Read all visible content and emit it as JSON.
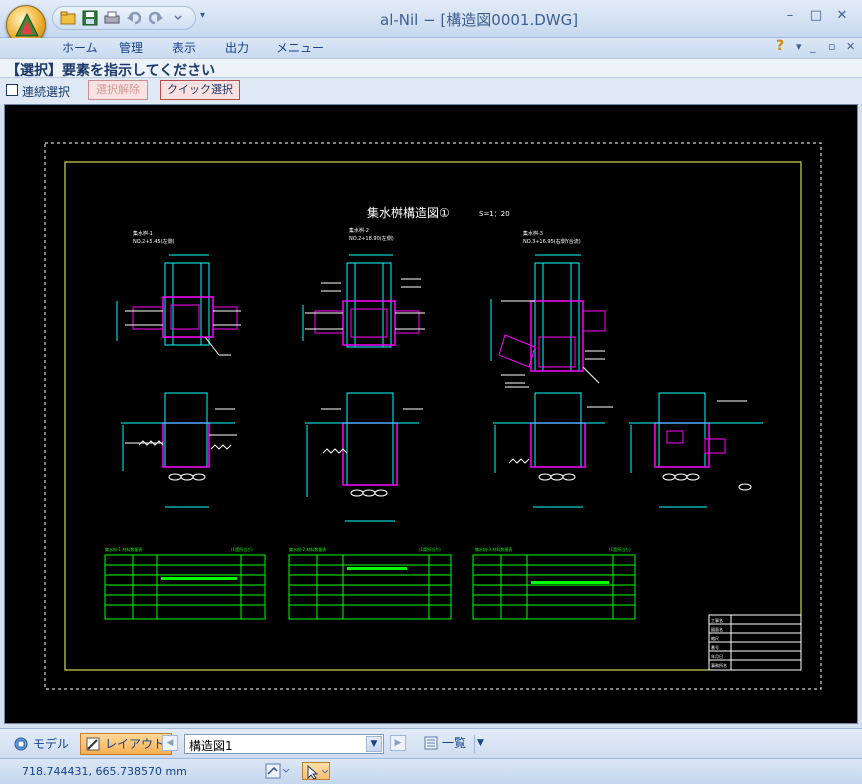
{
  "window": {
    "title": "al-Nil − [構造図0001.DWG]",
    "controls": {
      "minimize": "–",
      "maximize": "□",
      "close": "✕"
    }
  },
  "menu": {
    "items": [
      "ホーム",
      "管理",
      "表示",
      "出力",
      "メニュー"
    ],
    "help": "?",
    "mdi": {
      "minimize": "_",
      "restore": "▫",
      "close": "✕"
    }
  },
  "prompt": "【選択】要素を指示してください",
  "options": {
    "continuous_select": "連続選択",
    "deselect": "選択解除",
    "quick_select": "クイック選択"
  },
  "drawing": {
    "title": "集水桝構造図①",
    "scale": "S=1：20",
    "views": [
      {
        "name": "集水桝-1",
        "sub": "NO.2+5.45(左側)"
      },
      {
        "name": "集水桝-2",
        "sub": "NO.2+18.90(左側)"
      },
      {
        "name": "集水桝-3",
        "sub": "NO.3+16.95(右側Y合流)"
      }
    ],
    "tables": [
      {
        "left": "集水桝-1  材料数量表",
        "right": "(1箇所当り)"
      },
      {
        "left": "集水桝-2  材料数量表",
        "right": "(1箇所当り)"
      },
      {
        "left": "集水桝-3  材料数量表",
        "right": "(1箇所当り)"
      }
    ],
    "title_block": [
      "工事名",
      "図面名",
      "縮尺",
      "番号",
      "年月日",
      "事務所名"
    ]
  },
  "bottom": {
    "model_tab": "モデル",
    "layout_tab": "レイアウト",
    "sheet": "構造図1",
    "list": "一覧",
    "prev": "◀",
    "next": "▶",
    "dropdown": "▼"
  },
  "status": {
    "coordinates": "718.744431, 665.738570 mm"
  },
  "colors": {
    "canvas": "#000000",
    "cyan": "#00ffff",
    "magenta": "#ff00ff",
    "green": "#00ff00",
    "yellow": "#ffff66",
    "white": "#ffffff"
  }
}
